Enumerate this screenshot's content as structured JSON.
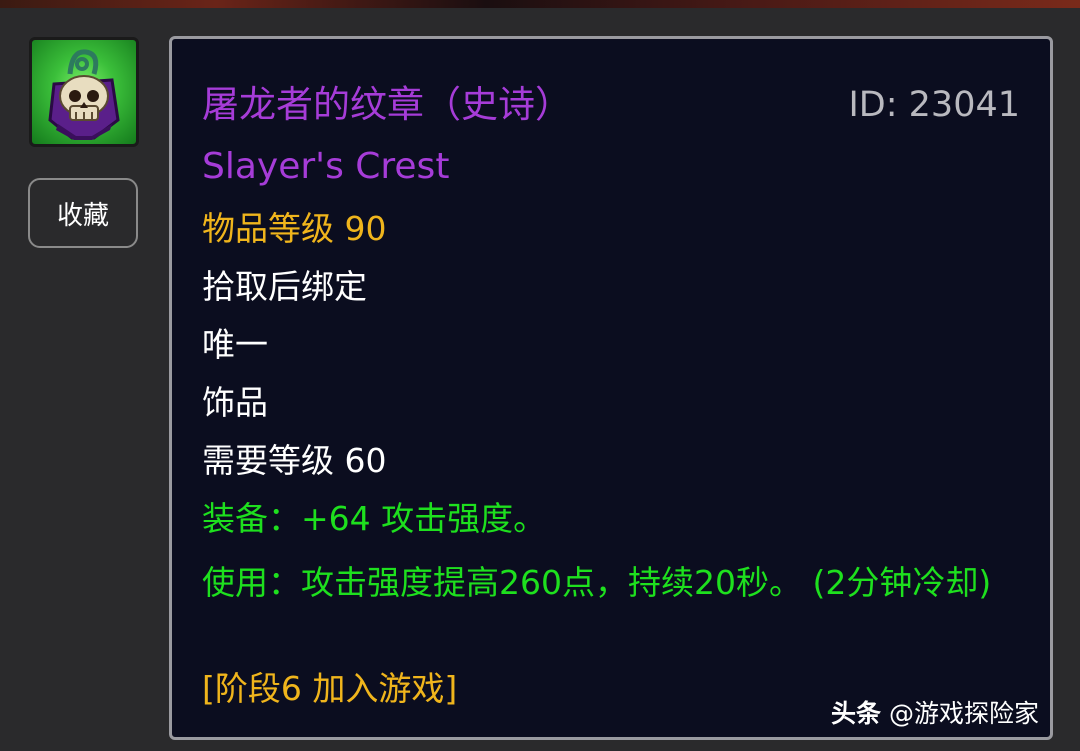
{
  "item": {
    "icon": "skull-trinket-icon",
    "title_cn": "屠龙者的纹章（史诗）",
    "title_en": "Slayer's Crest",
    "id_label": "ID: 23041",
    "item_level": "物品等级 90",
    "binding": "拾取后绑定",
    "unique": "唯一",
    "slot": "饰品",
    "required_level": "需要等级 60",
    "equip_effect": "装备：+64 攻击强度。",
    "use_effect": "使用：攻击强度提高260点，持续20秒。 (2分钟冷却)",
    "phase": "[阶段6 加入游戏]"
  },
  "buttons": {
    "favorite_label": "收藏"
  },
  "watermark": {
    "brand": "头条",
    "handle": "@游戏探险家"
  },
  "colors": {
    "epic": "#a63cd8",
    "gold": "#f0b51c",
    "green": "#1ee01e",
    "tooltip_bg": "#0b0d1f",
    "page_bg": "#2a2a2c"
  }
}
